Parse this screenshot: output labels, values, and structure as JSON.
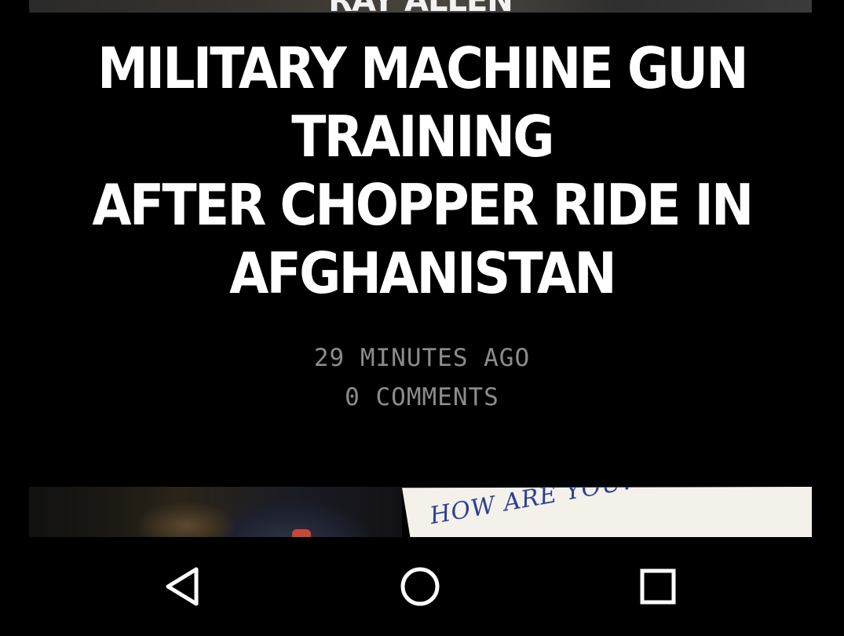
{
  "previous_article": {
    "partial_label": "RAY ALLEN"
  },
  "article": {
    "headline_lines": [
      "MILITARY MACHINE GUN",
      "TRAINING",
      "AFTER CHOPPER RIDE IN",
      "AFGHANISTAN"
    ],
    "time_ago": "29 MINUTES AGO",
    "comments": "0 COMMENTS"
  },
  "next_article": {
    "note_handwriting": "HOW ARE YOU? YOU ARE A"
  },
  "nav_bar": {
    "back_icon": "back-triangle-icon",
    "home_icon": "home-circle-icon",
    "recents_icon": "recents-square-icon",
    "icon_color": "#ffffff"
  },
  "colors": {
    "background": "#000000",
    "headline": "#ffffff",
    "meta": "#8c8c8c"
  }
}
